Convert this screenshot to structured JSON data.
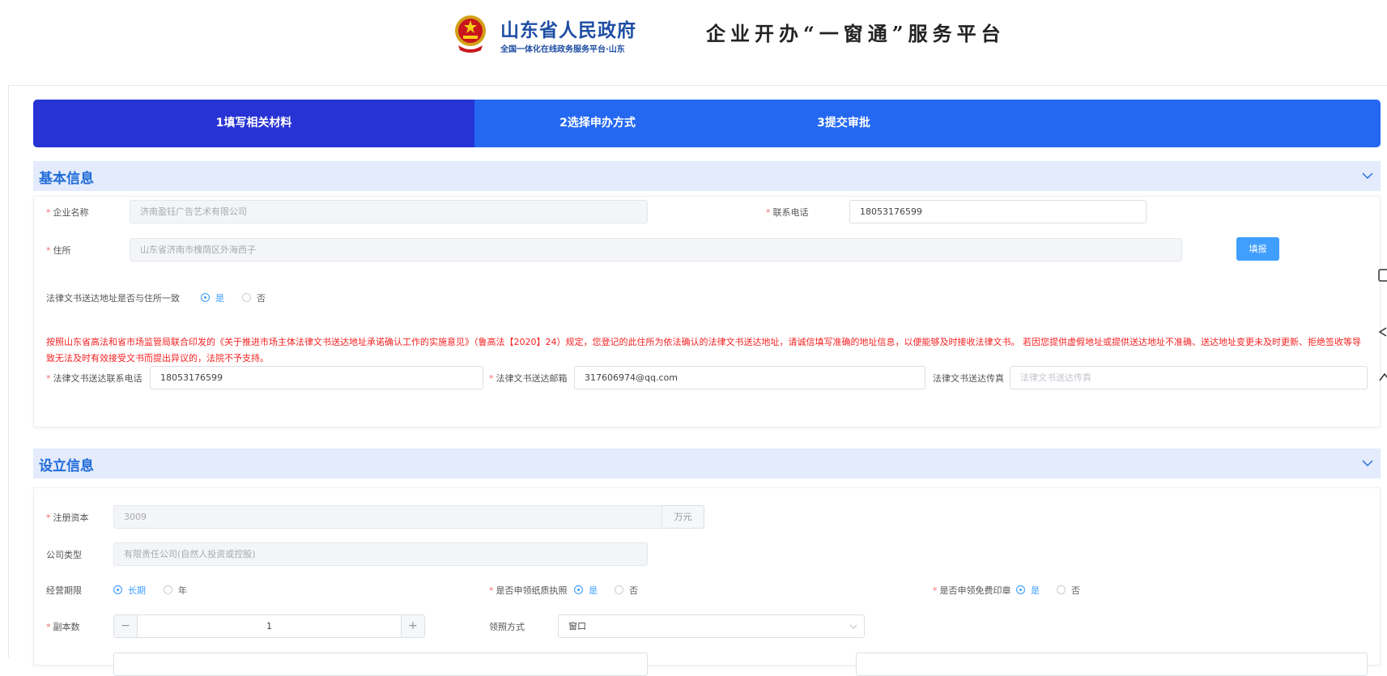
{
  "header": {
    "gov_name": "山东省人民政府",
    "gov_sub": "全国一体化在线政务服务平台·山东",
    "platform_title": "企业开办“一窗通”服务平台"
  },
  "steps": [
    {
      "label": "1填写相关材料",
      "active": true
    },
    {
      "label": "2选择申办方式",
      "active": false
    },
    {
      "label": "3提交审批",
      "active": false
    }
  ],
  "basic": {
    "title": "基本信息",
    "company_name_label": "企业名称",
    "company_name_value": "济南盈钰广告艺术有限公司",
    "phone_label": "联系电话",
    "phone_value": "18053176599",
    "address_label": "住所",
    "address_value": "山东省济南市槐荫区外海西子",
    "fill_button": "填报",
    "legal_same_label": "法律文书送达地址是否与住所一致",
    "yes": "是",
    "no": "否",
    "notice": "按照山东省高法和省市场监管局联合印发的《关于推进市场主体法律文书送达地址承诺确认工作的实施意见》（鲁高法【2020】24）规定，您登记的此住所为依法确认的法律文书送达地址，请诚信填写准确的地址信息，以便能够及时接收法律文书。 若因您提供虚假地址或提供送达地址不准确、送达地址变更未及时更新、拒绝签收等导致无法及时有效接受文书而提出异议的，法院不予支持。",
    "legal_phone_label": "法律文书送达联系电话",
    "legal_phone_value": "18053176599",
    "legal_email_label": "法律文书送达邮箱",
    "legal_email_value": "317606974@qq.com",
    "legal_fax_label": "法律文书送达传真",
    "legal_fax_placeholder": "法律文书送达传真"
  },
  "setup": {
    "title": "设立信息",
    "capital_label": "注册资本",
    "capital_value": "3009",
    "capital_unit": "万元",
    "company_type_label": "公司类型",
    "company_type_value": "有限责任公司(自然人投资或控股)",
    "term_label": "经营期限",
    "term_long": "长期",
    "term_year": "年",
    "paper_license_label": "是否申领纸质执照",
    "free_seal_label": "是否申领免费印章",
    "yes": "是",
    "no": "否",
    "copies_label": "副本数",
    "copies_value": "1",
    "minus": "−",
    "plus": "+",
    "pickup_label": "领照方式",
    "pickup_value": "窗口"
  },
  "colors": {
    "step_bar": "#2468f2",
    "step_active": "#2733d4",
    "section_bg": "#e3ebfc",
    "section_title": "#1f6bd8",
    "required": "#f56c6c",
    "notice": "#f52222",
    "primary": "#409eff"
  }
}
